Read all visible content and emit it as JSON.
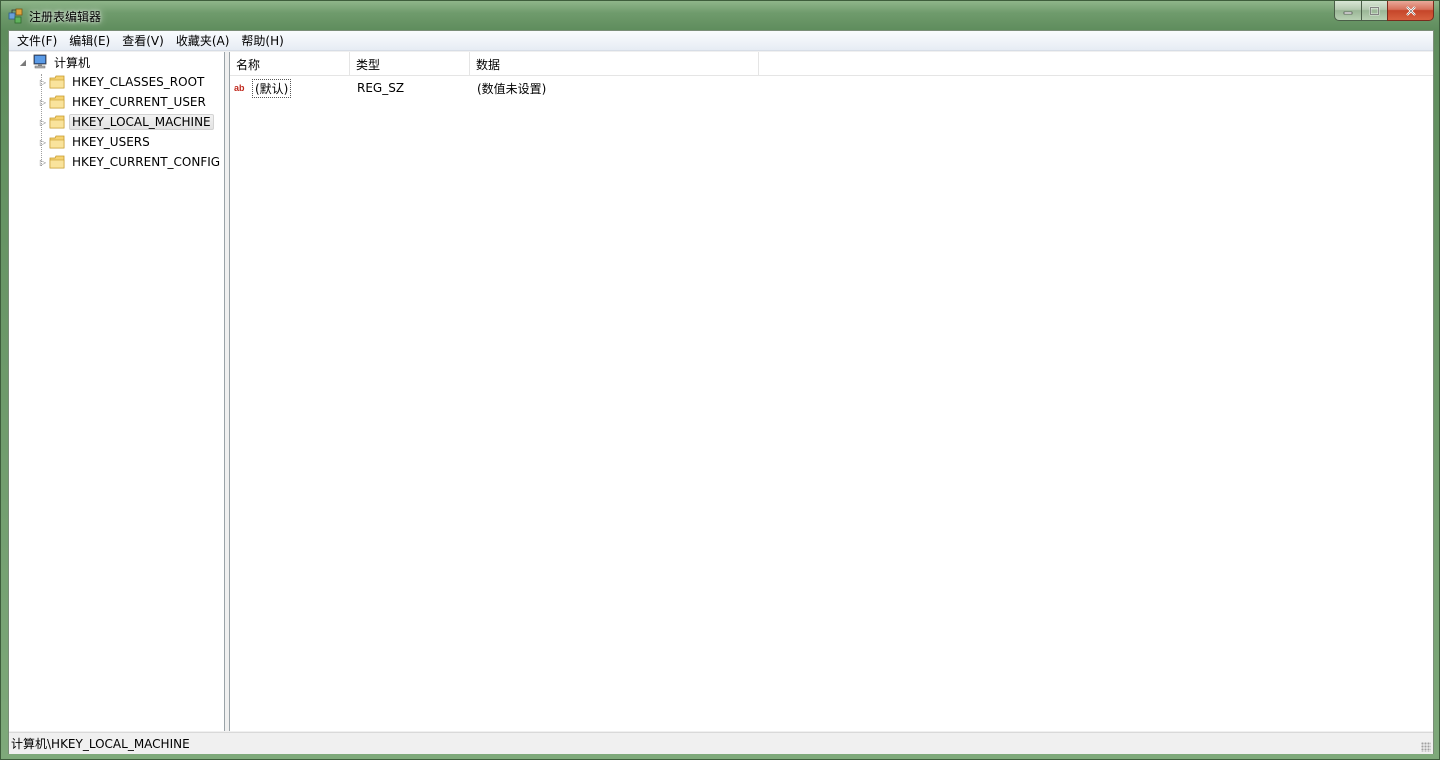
{
  "window": {
    "title": "注册表编辑器",
    "caption_buttons": {
      "minimize": "minimize",
      "maximize": "maximize",
      "close": "close"
    }
  },
  "menu": [
    "文件(F)",
    "编辑(E)",
    "查看(V)",
    "收藏夹(A)",
    "帮助(H)"
  ],
  "tree": {
    "root": "计算机",
    "items": [
      {
        "label": "HKEY_CLASSES_ROOT"
      },
      {
        "label": "HKEY_CURRENT_USER"
      },
      {
        "label": "HKEY_LOCAL_MACHINE",
        "selected": true
      },
      {
        "label": "HKEY_USERS"
      },
      {
        "label": "HKEY_CURRENT_CONFIG"
      }
    ]
  },
  "list": {
    "columns": [
      "名称",
      "类型",
      "数据"
    ],
    "rows": [
      {
        "name": "(默认)",
        "type": "REG_SZ",
        "data": "(数值未设置)",
        "icon": "ab"
      }
    ]
  },
  "status": {
    "path": "计算机\\HKEY_LOCAL_MACHINE"
  },
  "colors": {
    "folder": "#f5d273",
    "titlebar": "#6f9b6c",
    "close_button": "#c5452a",
    "selection": "#e2e2e2"
  }
}
